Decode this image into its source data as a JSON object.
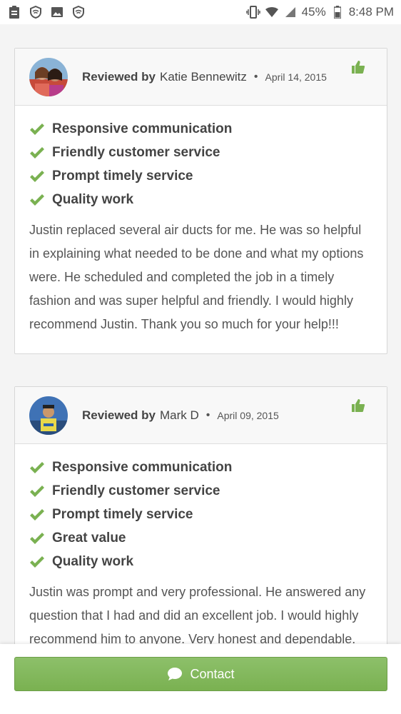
{
  "status_bar": {
    "battery": "45%",
    "time": "8:48 PM"
  },
  "reviews": [
    {
      "label": "Reviewed by",
      "name": "Katie Bennewitz",
      "separator": "•",
      "date": "April 14, 2015",
      "items": [
        "Responsive communication",
        "Friendly customer service",
        "Prompt timely service",
        "Quality work"
      ],
      "text": "Justin replaced several air ducts for me. He was so helpful in explaining what needed to be done and what my options were. He scheduled and completed the job in a timely fashion and was super helpful and friendly. I would highly recommend Justin. Thank you so much for your help!!!"
    },
    {
      "label": "Reviewed by",
      "name": "Mark D",
      "separator": "•",
      "date": "April 09, 2015",
      "items": [
        "Responsive communication",
        "Friendly customer service",
        "Prompt timely service",
        "Great value",
        "Quality work"
      ],
      "text": "Justin was prompt and very professional. He answered any question that I had and did an excellent job. I would highly recommend him to anyone. Very honest and dependable."
    }
  ],
  "contact": {
    "label": "Contact"
  },
  "colors": {
    "accent_green": "#7ab151",
    "check_green": "#7ab151"
  }
}
